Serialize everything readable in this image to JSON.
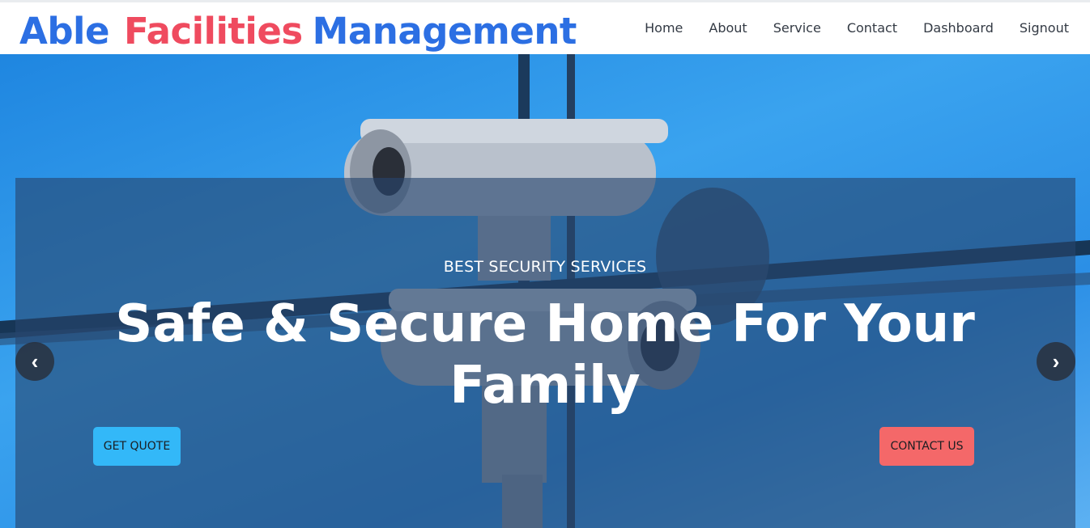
{
  "brand": {
    "word1": "Able",
    "word2": "Facilities",
    "word3": "Management"
  },
  "nav": {
    "items": [
      "Home",
      "About",
      "Service",
      "Contact",
      "Dashboard",
      "Signout"
    ]
  },
  "hero": {
    "subtitle": "BEST SECURITY SERVICES",
    "headline": "Safe & Secure Home For Your Family",
    "get_quote_label": "GET QUOTE",
    "contact_label": "CONTACT US",
    "prev_icon": "‹",
    "next_icon": "›"
  },
  "colors": {
    "brand_blue": "#2c6fe3",
    "brand_red": "#ef4b5f",
    "quote_button": "#33b8f8",
    "contact_button": "#f46869"
  }
}
